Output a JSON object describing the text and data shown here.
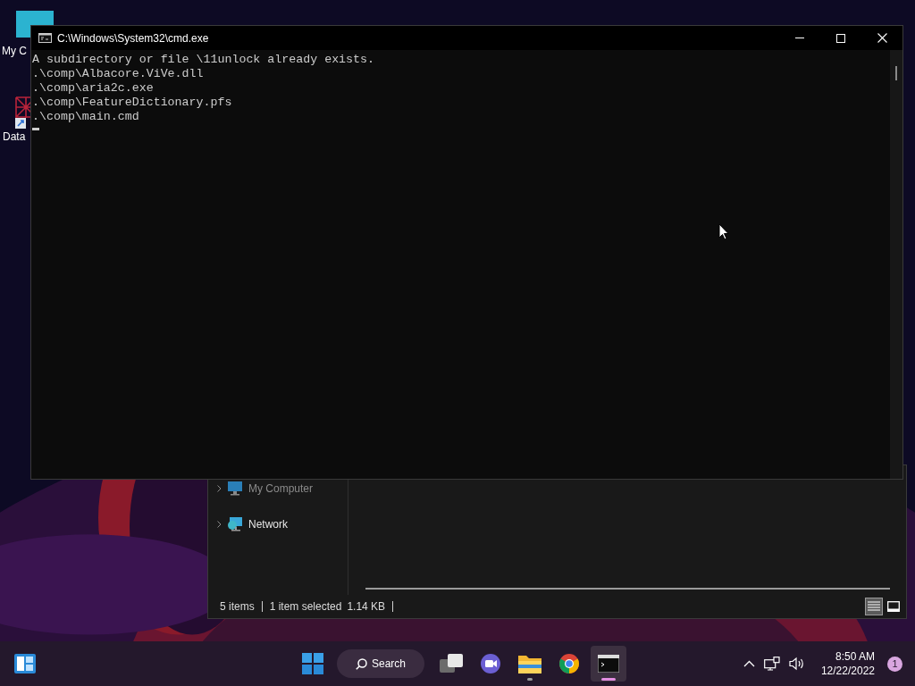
{
  "desktop_icons": [
    {
      "kind": "computer",
      "label": "My C"
    },
    {
      "kind": "shortcut",
      "label": "Data"
    }
  ],
  "explorer": {
    "nav_items": [
      {
        "kind": "computer",
        "label": "My Computer"
      },
      {
        "kind": "network",
        "label": "Network"
      }
    ],
    "status": [
      "5 items",
      "1 item selected",
      "1.14 KB"
    ],
    "view_buttons": [
      {
        "kind": "details",
        "selected": true
      },
      {
        "kind": "tiles",
        "selected": false
      }
    ]
  },
  "console": {
    "title": "C:\\Windows\\System32\\cmd.exe",
    "lines": [
      "A subdirectory or file \\11unlock already exists.",
      ".\\comp\\Albacore.ViVe.dll",
      ".\\comp\\aria2c.exe",
      ".\\comp\\FeatureDictionary.pfs",
      ".\\comp\\main.cmd"
    ]
  },
  "taskbar": {
    "search": "Search",
    "apps": [
      {
        "kind": "task-view",
        "running": false,
        "active": false
      },
      {
        "kind": "meet",
        "running": false,
        "active": false
      },
      {
        "kind": "explorer",
        "running": true,
        "active": false
      },
      {
        "kind": "chrome",
        "running": false,
        "active": false
      },
      {
        "kind": "terminal",
        "running": true,
        "active": true
      }
    ],
    "time": "8:50 AM",
    "date": "12/22/2022",
    "notifications": "1"
  }
}
